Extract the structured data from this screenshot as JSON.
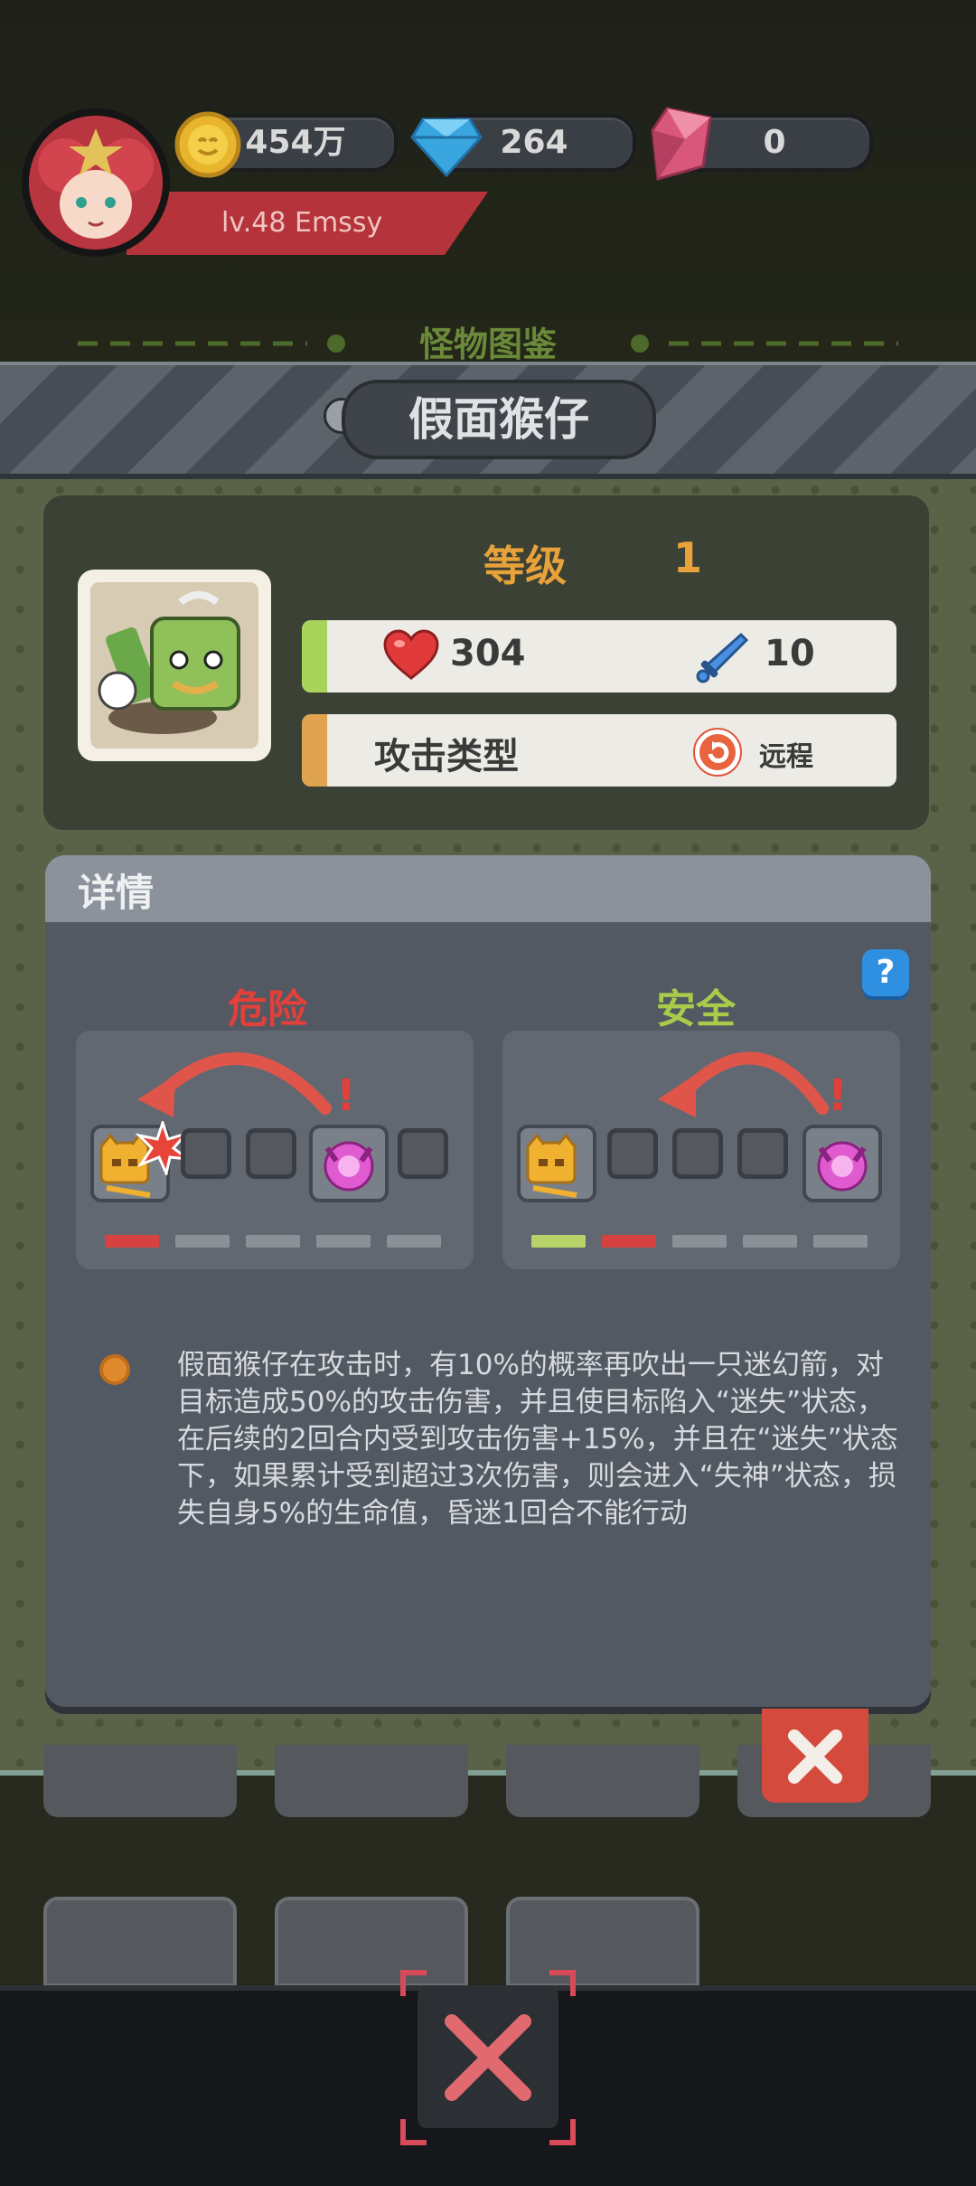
{
  "player": {
    "coins": "454万",
    "gems": "264",
    "crystals": "0",
    "level_name": "lv.48  Emssy"
  },
  "section_title": "怪物图鉴",
  "monster": {
    "name": "假面猴仔",
    "grade_label": "等级",
    "grade_value": "1",
    "hp": "304",
    "attack": "10",
    "attack_type_label": "攻击类型",
    "attack_type_value": "远程"
  },
  "details": {
    "title": "详情",
    "help": "?",
    "danger_label": "危险",
    "safe_label": "安全",
    "danger_alert": "!",
    "safe_alert": "!",
    "description": "假面猴仔在攻击时，有10%的概率再吹出一只迷幻箭，对目标造成50%的攻击伤害，并且使目标陷入“迷失”状态，在后续的2回合内受到攻击伤害+15%，并且在“迷失”状态下，如果累计受到超过3次伤害，则会进入“失神”状态，损失自身5%的生命值，昏迷1回合不能行动"
  },
  "colors": {
    "danger": "#e2403a",
    "safe": "#a8cb4a",
    "grade": "#e8a23a",
    "hp_bar": "#a9d35a",
    "type_bar": "#e0a450"
  },
  "icons": [
    "coin-icon",
    "gem-icon",
    "crystal-icon",
    "heart-icon",
    "sword-icon",
    "ranged-icon",
    "help-icon",
    "close-icon"
  ]
}
